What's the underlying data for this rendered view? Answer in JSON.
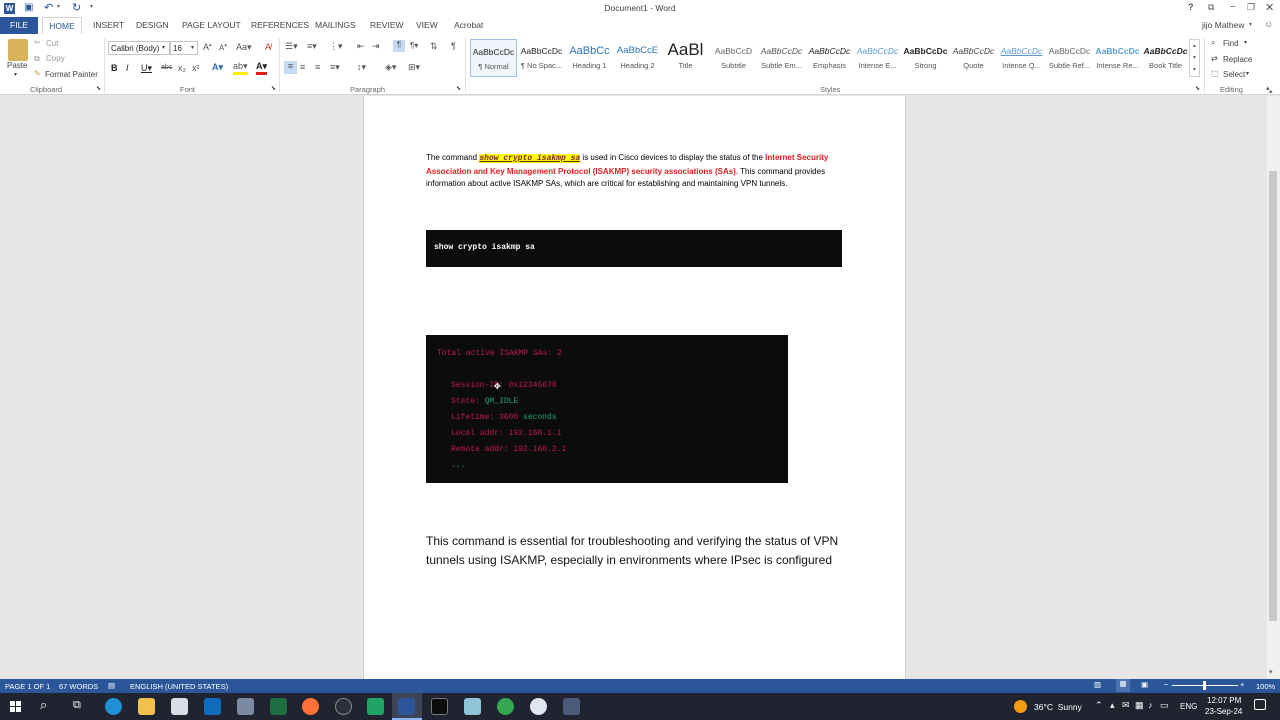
{
  "window": {
    "title": "Document1 - Word",
    "user": "jijo Mathew"
  },
  "tabs": [
    "FILE",
    "HOME",
    "INSERT",
    "DESIGN",
    "PAGE LAYOUT",
    "REFERENCES",
    "MAILINGS",
    "REVIEW",
    "VIEW",
    "Acrobat"
  ],
  "clipboard": {
    "paste": "Paste",
    "cut": "Cut",
    "copy": "Copy",
    "format_painter": "Format Painter",
    "label": "Clipboard"
  },
  "font": {
    "name": "Calibri (Body)",
    "size": "16",
    "label": "Font"
  },
  "paragraph": {
    "label": "Paragraph"
  },
  "styles": {
    "label": "Styles",
    "items": [
      {
        "preview": "AaBbCcDc",
        "name": "¶ Normal"
      },
      {
        "preview": "AaBbCcDc",
        "name": "¶ No Spac..."
      },
      {
        "preview": "AaBbCc",
        "name": "Heading 1"
      },
      {
        "preview": "AaBbCcE",
        "name": "Heading 2"
      },
      {
        "preview": "AaBl",
        "name": "Title"
      },
      {
        "preview": "AaBbCcD",
        "name": "Subtitle"
      },
      {
        "preview": "AaBbCcDc",
        "name": "Subtle Em..."
      },
      {
        "preview": "AaBbCcDc",
        "name": "Emphasis"
      },
      {
        "preview": "AaBbCcDc",
        "name": "Intense E..."
      },
      {
        "preview": "AaBbCcDc",
        "name": "Strong"
      },
      {
        "preview": "AaBbCcDc",
        "name": "Quote"
      },
      {
        "preview": "AaBbCcDc",
        "name": "Intense Q..."
      },
      {
        "preview": "AaBbCcDc",
        "name": "Subtle Ref..."
      },
      {
        "preview": "AaBbCcDc",
        "name": "Intense Re..."
      },
      {
        "preview": "AaBbCcDc",
        "name": "Book Title"
      }
    ]
  },
  "editing": {
    "find": "Find",
    "replace": "Replace",
    "select": "Select",
    "label": "Editing"
  },
  "document": {
    "p1_a": "The command ",
    "p1_cmd": "show crypto isakmp sa",
    "p1_b": " is used in Cisco devices to display the status of the ",
    "p1_red": "Internet Security Association and Key Management Protocol (ISAKMP) security associations (SAs)",
    "p1_c": ". This command provides information about active ISAKMP SAs, which are critical for establishing and maintaining VPN tunnels.",
    "term1": "show crypto isakmp sa",
    "term2": {
      "l1": "Total active ISAKMP SAs: 2",
      "l2": "Session-ID: 0x12345678",
      "l3a": "State: ",
      "l3b": "QM_IDLE",
      "l4a": "Lifetime: 3600 ",
      "l4b": "seconds",
      "l5": "Local addr: 192.168.1.1",
      "l6": "Remote addr: 192.168.2.1",
      "l7": "..."
    },
    "p2": "This command is essential for troubleshooting and verifying the status of VPN tunnels using ISAKMP, especially in environments where IPsec is configured"
  },
  "status": {
    "page": "PAGE 1 OF 1",
    "words": "67 WORDS",
    "language": "ENGLISH (UNITED STATES)",
    "zoom": "100%"
  },
  "taskbar": {
    "weather": "36°C  Sunny",
    "lang": "ENG",
    "time": "12:07 PM",
    "date": "23-Sep-24"
  }
}
